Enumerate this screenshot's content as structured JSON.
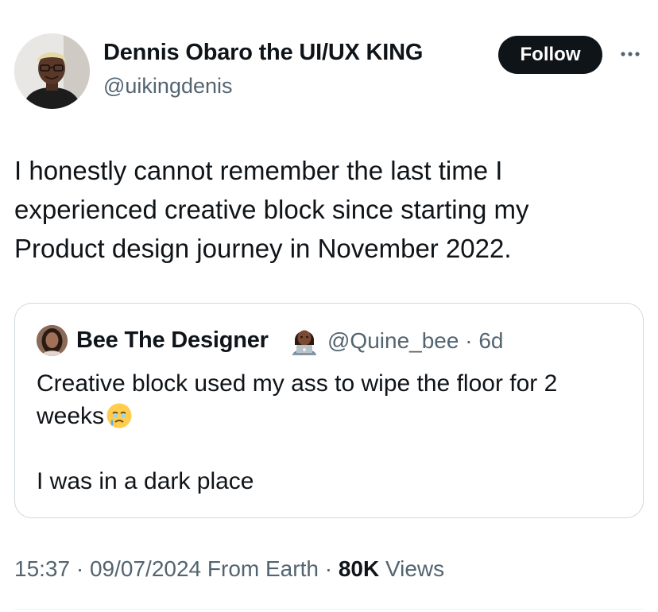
{
  "author": {
    "name": "Dennis Obaro the UI/UX KING",
    "handle": "@uikingdenis"
  },
  "follow_label": "Follow",
  "more_icon": "more-horizontal-icon",
  "tweet_text_lines": [
    "I honestly cannot remember the last time I",
    "experienced creative block since starting my",
    "Product design journey in November 2022."
  ],
  "quote": {
    "name": "Bee The Designer",
    "name_emoji": "woman-technologist-emoji",
    "meta": "@Quine_bee · 6d",
    "line1": "Creative block used my ass to wipe the floor for 2",
    "line2": "weeks",
    "line2_emoji": "face-holding-back-tears-emoji",
    "line3": "I was in a dark place"
  },
  "footer": {
    "time": "15:37",
    "date": "09/07/2024",
    "location": "From Earth",
    "views_count": "80K",
    "views_label": "Views",
    "separator": "·"
  },
  "colors": {
    "text_primary": "#0f1419",
    "text_secondary": "#536471",
    "border": "#cfd9de",
    "follow_bg": "#0f1419",
    "follow_text": "#ffffff"
  }
}
